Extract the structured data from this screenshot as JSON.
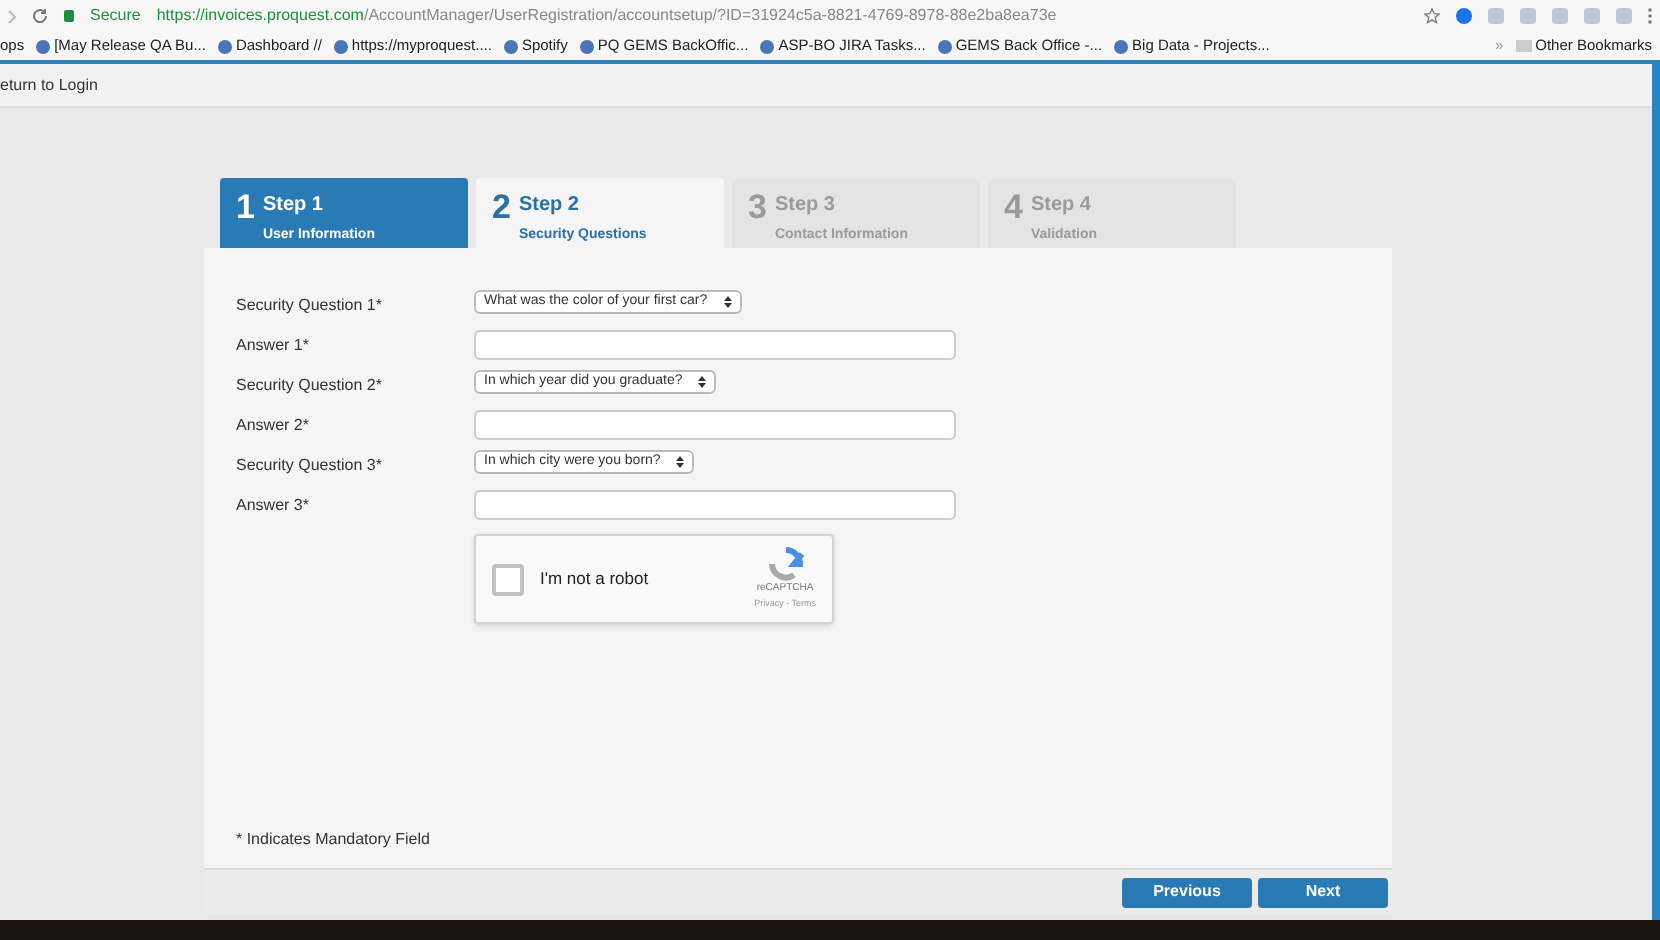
{
  "browser": {
    "secure_label": "Secure",
    "url_host": "https://invoices.proquest.com",
    "url_path": "/AccountManager/UserRegistration/accountsetup/?ID=31924c5a-8821-4769-8978-88e2ba8ea73e",
    "bookmarks": [
      "ops",
      "[May Release QA Bu...",
      "Dashboard //",
      "https://myproquest....",
      "Spotify",
      "PQ GEMS BackOffic...",
      "ASP-BO JIRA Tasks...",
      "GEMS Back Office -...",
      "Big Data - Projects..."
    ],
    "more": "»",
    "other_bookmarks": "Other Bookmarks"
  },
  "return_link": "eturn to Login",
  "steps": [
    {
      "number": "1",
      "title": "Step 1",
      "subtitle": "User Information",
      "completed": true,
      "selected": false
    },
    {
      "number": "2",
      "title": "Step 2",
      "subtitle": "Security Questions",
      "completed": false,
      "selected": true
    },
    {
      "number": "3",
      "title": "Step 3",
      "subtitle": "Contact Information",
      "completed": false,
      "selected": false
    },
    {
      "number": "4",
      "title": "Step 4",
      "subtitle": "Validation",
      "completed": false,
      "selected": false
    }
  ],
  "form": [
    {
      "kind": "select",
      "label": "Security Question 1*",
      "value": "What was the color of your first car?"
    },
    {
      "kind": "input",
      "label": "Answer 1*"
    },
    {
      "kind": "select",
      "label": "Security Question 2*",
      "value": "In which year did you graduate?"
    },
    {
      "kind": "input",
      "label": "Answer 2*"
    },
    {
      "kind": "select",
      "label": "Security Question 3*",
      "value": "In which city were you born?"
    },
    {
      "kind": "input",
      "label": "Answer 3*"
    }
  ],
  "captcha": {
    "label": "I'm not a robot",
    "checked": false,
    "brand": "reCAPTCHA",
    "links": "Privacy - Terms"
  },
  "note": "* Indicates Mandatory Field",
  "buttons": [
    "Previous",
    "Next"
  ]
}
